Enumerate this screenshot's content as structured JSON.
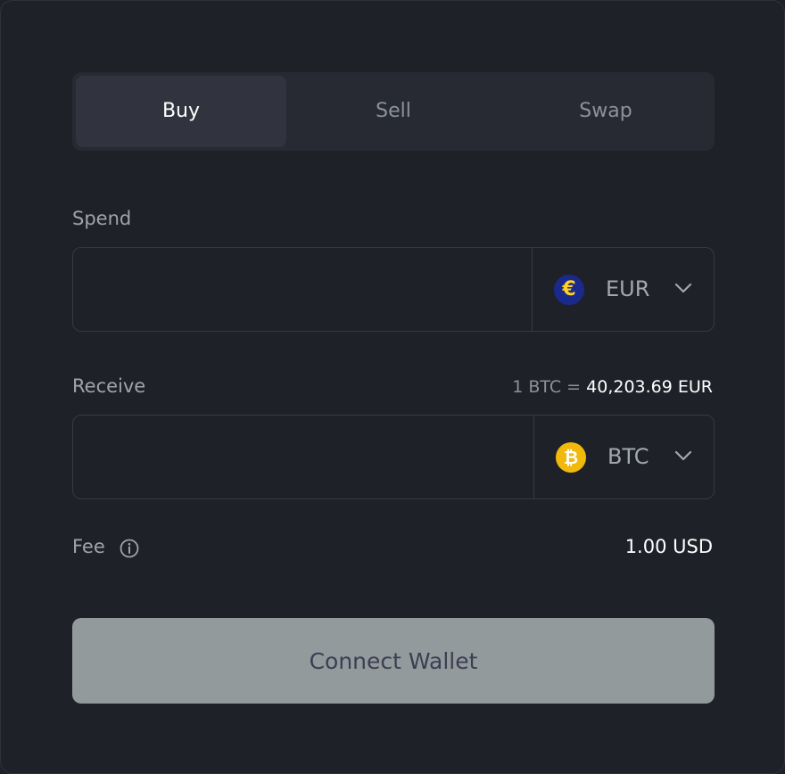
{
  "tabs": [
    {
      "label": "Buy",
      "active": true
    },
    {
      "label": "Sell",
      "active": false
    },
    {
      "label": "Swap",
      "active": false
    }
  ],
  "spend": {
    "label": "Spend",
    "amount_value": "",
    "currency": {
      "code": "EUR",
      "icon": "euro-coin-icon",
      "symbol": "€"
    }
  },
  "receive": {
    "label": "Receive",
    "rate_prefix": "1 BTC =",
    "rate_value": "40,203.69 EUR",
    "amount_value": "",
    "currency": {
      "code": "BTC",
      "icon": "bitcoin-coin-icon",
      "symbol": "₿"
    }
  },
  "fee": {
    "label": "Fee",
    "value": "1.00 USD",
    "info_icon": "info-icon"
  },
  "connect_button": {
    "label": "Connect Wallet"
  },
  "colors": {
    "background": "#1f2129",
    "tab_bar": "#272a33",
    "tab_active": "#31343e",
    "border": "#353944",
    "euro_coin": "#1a2a8c",
    "euro_symbol": "#ffd21f",
    "bitcoin_coin": "#f0b90b",
    "button_bg": "#939a9c",
    "button_text": "#3a3f52"
  }
}
